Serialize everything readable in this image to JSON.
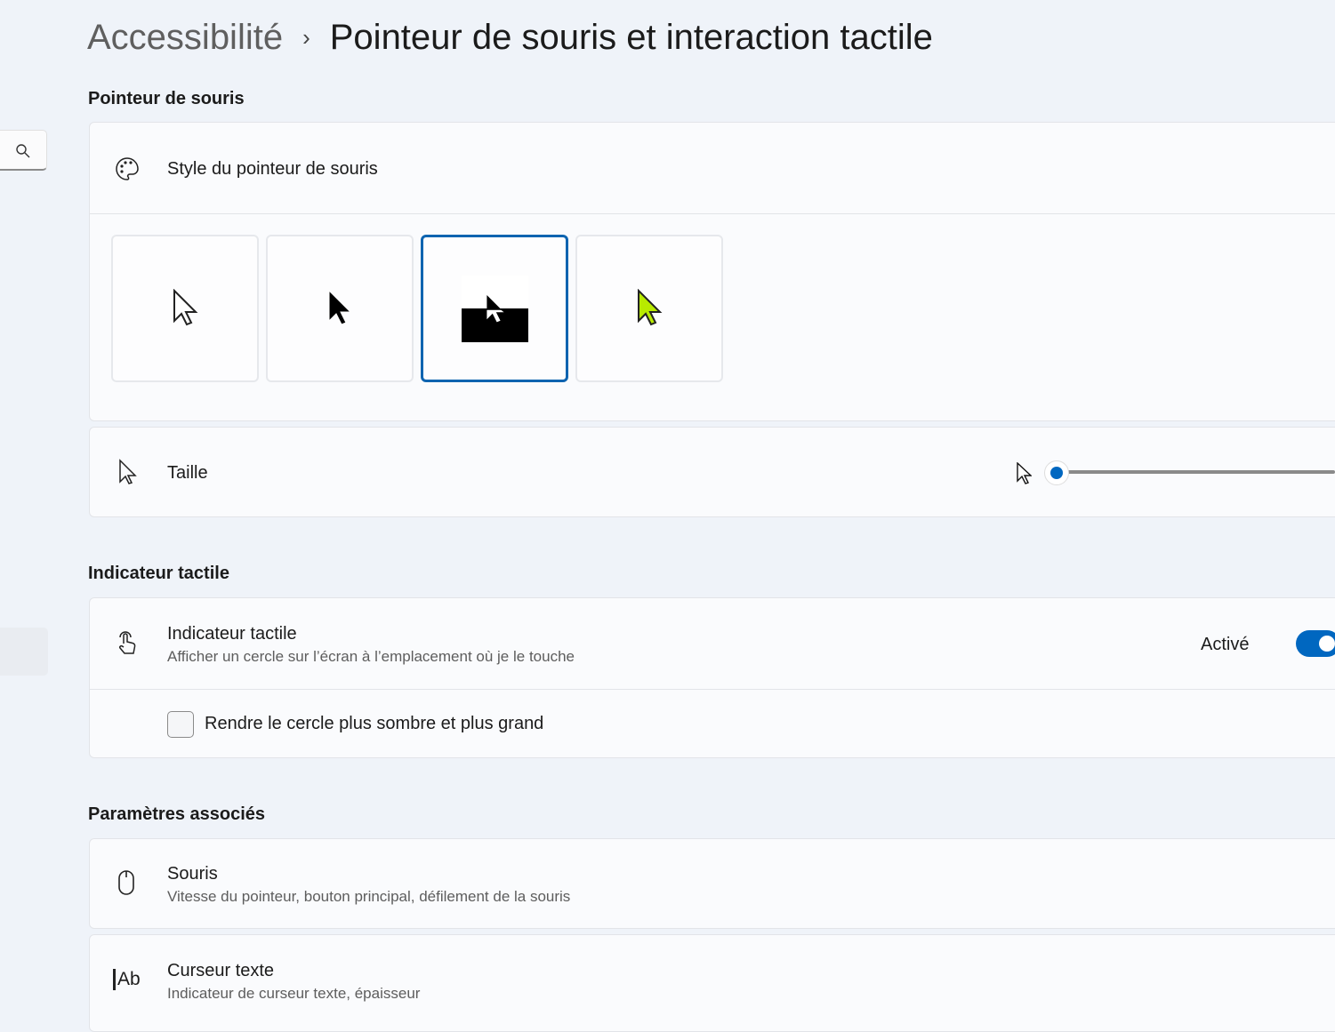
{
  "breadcrumb": {
    "parent": "Accessibilité",
    "separator": "›",
    "current": "Pointeur de souris et interaction tactile"
  },
  "sections": {
    "mouse_pointer": {
      "title": "Pointeur de souris",
      "style_label": "Style du pointeur de souris",
      "styles": [
        {
          "name": "white",
          "selected": false
        },
        {
          "name": "black",
          "selected": false
        },
        {
          "name": "inverted",
          "selected": true
        },
        {
          "name": "custom",
          "selected": false,
          "color": "#b8ea00"
        }
      ],
      "size_label": "Taille",
      "size_value_fraction": 0.0
    },
    "touch": {
      "title": "Indicateur tactile",
      "item_title": "Indicateur tactile",
      "item_sub": "Afficher un cercle sur l’écran à l’emplacement où je le touche",
      "state": "Activé",
      "toggle_on": true,
      "checkbox_label": "Rendre le cercle plus sombre et plus grand",
      "checkbox_checked": false
    },
    "related": {
      "title": "Paramètres associés",
      "items": [
        {
          "title": "Souris",
          "sub": "Vitesse du pointeur, bouton principal, défilement de la souris"
        },
        {
          "title": "Curseur texte",
          "sub": "Indicateur de curseur texte, épaisseur"
        }
      ]
    }
  },
  "colors": {
    "accent": "#0067c0"
  }
}
